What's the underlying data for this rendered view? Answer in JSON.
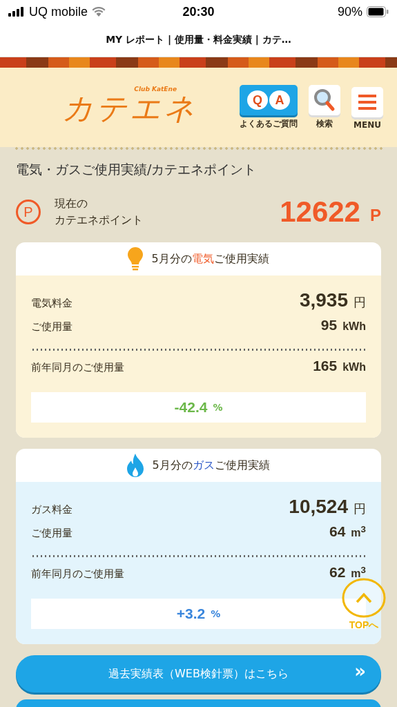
{
  "status_bar": {
    "carrier": "UQ mobile",
    "time": "20:30",
    "battery": "90%"
  },
  "page_title": "MY レポート | 使用量・料金実績 | カテ…",
  "header": {
    "logo": "カテエネ",
    "logo_sub": "Club KatEne",
    "nav": [
      {
        "kind": "qa",
        "label": "よくあるご質問",
        "letters": [
          "Q",
          "A"
        ]
      },
      {
        "kind": "search",
        "label": "検索"
      },
      {
        "kind": "menu",
        "label": "MENU"
      }
    ]
  },
  "section_title": "電気・ガスご使用実績/カテエネポイント",
  "points": {
    "icon": "P",
    "label_lines": [
      "現在の",
      "カテエネポイント"
    ],
    "value": "12622",
    "unit": "P"
  },
  "cards": [
    {
      "kind": "electric",
      "title_pre": "5月分の",
      "title_highlight": "電気",
      "color": "#f05a28",
      "title_post": "ご使用実績",
      "rows": [
        {
          "label": "電気料金",
          "value": "3,935",
          "unit": "円",
          "big": true
        },
        {
          "label": "ご使用量",
          "value": "95",
          "unit": "kWh",
          "big": false
        },
        {
          "label": "前年同月のご使用量",
          "value": "165",
          "unit": "kWh",
          "big": false
        }
      ],
      "change": {
        "value": "-42.4",
        "unit": "%",
        "color": "#6cb84a"
      }
    },
    {
      "kind": "gas",
      "title_pre": "5月分の",
      "title_highlight": "ガス",
      "color": "#2a56c6",
      "title_post": "ご使用実績",
      "rows": [
        {
          "label": "ガス料金",
          "value": "10,524",
          "unit": "円",
          "big": true
        },
        {
          "label": "ご使用量",
          "value": "64",
          "unit": "m$^{3}$",
          "big": false
        },
        {
          "label": "前年同月のご使用量",
          "value": "62",
          "unit": "m$^{3}$",
          "big": false
        }
      ],
      "change": {
        "value": "+3.2",
        "unit": "%",
        "color": "#3a86dc"
      }
    }
  ],
  "buttons": [
    {
      "label": "過去実績表（WEB検針票）はこちら",
      "arrow": "»"
    }
  ],
  "top_button": {
    "label": "TOPへ"
  }
}
